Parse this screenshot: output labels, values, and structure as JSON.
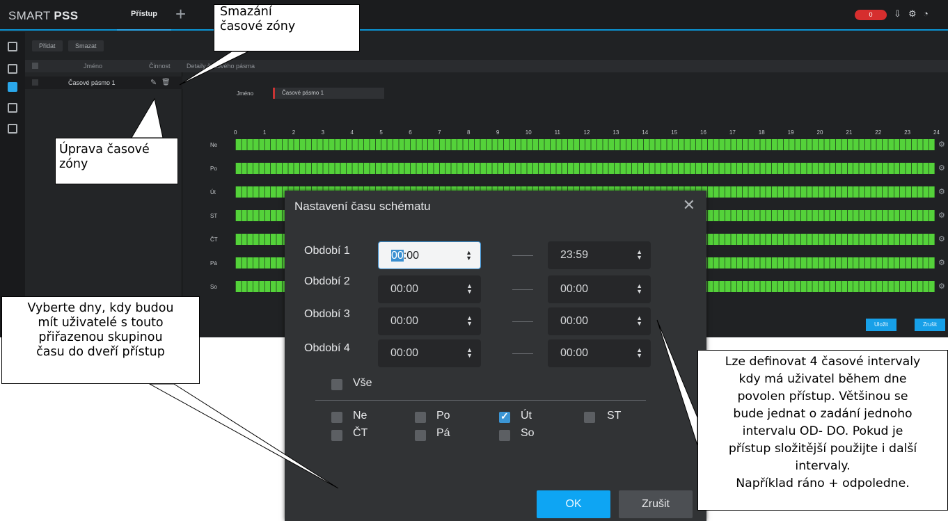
{
  "app": {
    "brand_light": "SMART ",
    "brand_bold": "PSS",
    "active_tab": "Přístup",
    "add_tab_glyph": "+",
    "alarm_count": "0",
    "accent_color": "#0a95d6"
  },
  "toolbar": {
    "add_label": "Přidat",
    "delete_label": "Smazat"
  },
  "list": {
    "col_name": "Jméno",
    "col_action": "Činnost",
    "row_name": "Časové pásmo 1"
  },
  "detail": {
    "header": "Detaily časového pásma",
    "name_label": "Jméno",
    "name_value": "Časové pásmo 1",
    "hours": [
      "0",
      "1",
      "2",
      "3",
      "4",
      "5",
      "6",
      "7",
      "8",
      "9",
      "10",
      "11",
      "12",
      "13",
      "14",
      "15",
      "16",
      "17",
      "18",
      "19",
      "20",
      "21",
      "22",
      "23",
      "24"
    ],
    "days": [
      "Ne",
      "Po",
      "Út",
      "ST",
      "ČT",
      "Pá",
      "So"
    ],
    "save_label": "Uložit",
    "cancel_label": "Zrušit",
    "bar_color": "#4cc437"
  },
  "dialog": {
    "title": "Nastavení času schématu",
    "close_glyph": "✕",
    "periods": [
      {
        "label": "Období 1",
        "from_hl": "00",
        "from_rest": ":00",
        "to": "23:59"
      },
      {
        "label": "Období 2",
        "from": "00:00",
        "to": "00:00"
      },
      {
        "label": "Období 3",
        "from": "00:00",
        "to": "00:00"
      },
      {
        "label": "Období 4",
        "from": "00:00",
        "to": "00:00"
      }
    ],
    "all_label": "Vše",
    "day_checks": [
      {
        "label": "Ne",
        "checked": false
      },
      {
        "label": "Po",
        "checked": false
      },
      {
        "label": "Út",
        "checked": true
      },
      {
        "label": "ST",
        "checked": false
      },
      {
        "label": "ČT",
        "checked": false
      },
      {
        "label": "Pá",
        "checked": false
      },
      {
        "label": "So",
        "checked": false
      }
    ],
    "ok_label": "OK",
    "cancel_label": "Zrušit",
    "ok_color": "#0ea5f3"
  },
  "callouts": {
    "delete": [
      "Smazání",
      "časové zóny"
    ],
    "edit": [
      "Úprava časové",
      "zóny"
    ],
    "days": [
      "Vyberte dny, kdy budou",
      "mít uživatelé s touto",
      "přiřazenou skupinou",
      "času do dveří přístup"
    ],
    "intervals": [
      "Lze definovat 4 časové intervaly",
      "kdy má uživatel během dne",
      "povolen přístup. Většinou se",
      "bude jednat o zadání jednoho",
      "intervalu OD- DO. Pokud je",
      "přístup složitější použijte i další",
      "intervaly.",
      "Například ráno + odpoledne."
    ]
  }
}
